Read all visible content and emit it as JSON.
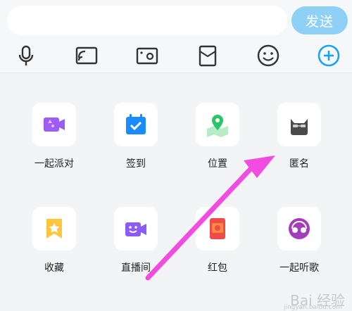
{
  "composer": {
    "input_value": "",
    "send_label": "发送"
  },
  "toolbar": {
    "icons": [
      "microphone-icon",
      "screen-cast-icon",
      "photo-icon",
      "red-envelope-icon",
      "emoji-icon",
      "plus-icon"
    ]
  },
  "panel": {
    "items": [
      {
        "label": "一起派对",
        "icon": "party-video-icon"
      },
      {
        "label": "签到",
        "icon": "check-in-calendar-icon"
      },
      {
        "label": "位置",
        "icon": "location-map-icon"
      },
      {
        "label": "匿名",
        "icon": "anonymous-cat-icon"
      },
      {
        "label": "收藏",
        "icon": "favorites-star-icon"
      },
      {
        "label": "直播间",
        "icon": "live-room-icon"
      },
      {
        "label": "红包",
        "icon": "red-packet-icon"
      },
      {
        "label": "一起听歌",
        "icon": "listen-together-headphones-icon"
      }
    ]
  },
  "watermark": {
    "text": "Bai 经验",
    "sub": "jingyan.baidu.com"
  },
  "colors": {
    "send_button": "#8fd0f6",
    "accent_blue": "#1aa3f0",
    "annotation_arrow": "#f14be0"
  }
}
